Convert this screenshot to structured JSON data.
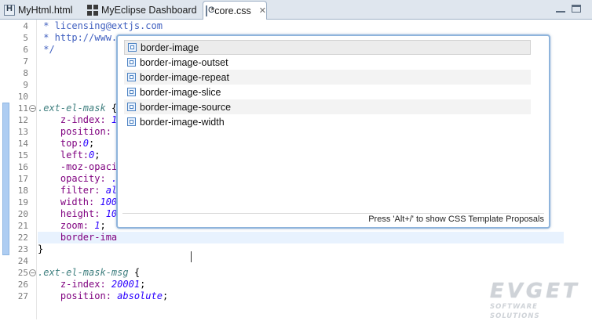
{
  "tabs": [
    {
      "label": "MyHtml.html",
      "icon": "html-file-icon"
    },
    {
      "label": "MyEclipse Dashboard",
      "icon": "dashboard-icon"
    },
    {
      "label": "*core.css",
      "icon": "css-file-icon",
      "active": true
    }
  ],
  "editor": {
    "lines": [
      {
        "num": "4",
        "text": " * licensing@extjs.com"
      },
      {
        "num": "5",
        "text": " * http://www."
      },
      {
        "num": "6",
        "text": " */"
      },
      {
        "num": "7",
        "text": ""
      },
      {
        "num": "8",
        "text": ""
      },
      {
        "num": "9",
        "text": ""
      },
      {
        "num": "10",
        "text": ""
      },
      {
        "num": "11",
        "selector": ".ext-el-mask",
        "text": " {"
      },
      {
        "num": "12",
        "prop": "    z-index:",
        "val": " 1"
      },
      {
        "num": "13",
        "prop": "    position:",
        "val": ""
      },
      {
        "num": "14",
        "prop": "    top:",
        "val": "0",
        "end": ";"
      },
      {
        "num": "15",
        "prop": "    left:",
        "val": "0",
        "end": ";"
      },
      {
        "num": "16",
        "prop": "    -moz-opaci",
        "val": ""
      },
      {
        "num": "17",
        "prop": "    opacity:",
        "val": " ."
      },
      {
        "num": "18",
        "prop": "    filter:",
        "val": " al"
      },
      {
        "num": "19",
        "prop": "    width:",
        "val": " 100"
      },
      {
        "num": "20",
        "prop": "    height:",
        "val": " 10"
      },
      {
        "num": "21",
        "prop": "    zoom:",
        "val": " 1",
        "end": ";"
      },
      {
        "num": "22",
        "prop": "    border-ima",
        "val": ""
      },
      {
        "num": "23",
        "text": "}"
      },
      {
        "num": "24",
        "text": ""
      },
      {
        "num": "25",
        "selector": ".ext-el-mask-msg",
        "text": " {"
      },
      {
        "num": "26",
        "prop": "    z-index:",
        "val": " 20001",
        "end": ";"
      },
      {
        "num": "27",
        "prop": "    position:",
        "val": " absolute",
        "end": ";"
      }
    ]
  },
  "completion": {
    "items": [
      "border-image",
      "border-image-outset",
      "border-image-repeat",
      "border-image-slice",
      "border-image-source",
      "border-image-width"
    ],
    "footer": "Press 'Alt+/' to show CSS Template Proposals"
  },
  "watermark": {
    "brand": "EVGET",
    "tagline": "SOFTWARE SOLUTIONS"
  },
  "colors": {
    "comment": "#3f5fbf",
    "selector": "#3f7f7f",
    "property": "#7f007f",
    "value": "#2a00ff",
    "current_line": "#e8f2fe",
    "popup_border": "#8fb4dc"
  }
}
